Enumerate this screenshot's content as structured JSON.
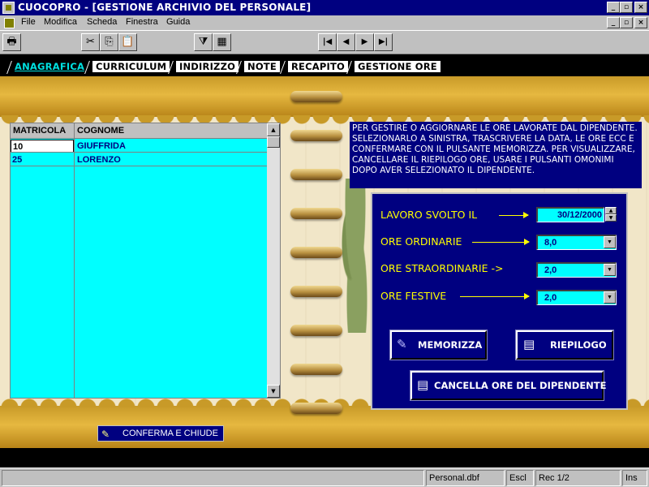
{
  "window": {
    "title": "CUOCOPRO - [GESTIONE ARCHIVIO DEL PERSONALE]",
    "controls": [
      "_",
      "▫",
      "×"
    ],
    "mdi_controls": [
      "_",
      "▫",
      "×"
    ]
  },
  "menu": {
    "items": [
      "File",
      "Modifica",
      "Scheda",
      "Finestra",
      "Guida"
    ]
  },
  "toolbar": {
    "buttons": [
      "printer-icon",
      "scissors-icon",
      "copy-icon",
      "paste-icon",
      "filter-icon",
      "grid-add-icon"
    ],
    "nav": [
      "|◀",
      "◀",
      "▶",
      "▶|"
    ]
  },
  "tabs": {
    "active": "ANAGRAFICA",
    "items": [
      "ANAGRAFICA",
      "CURRICULUM",
      "INDIRIZZO",
      "NOTE",
      "RECAPITO",
      "GESTIONE ORE"
    ]
  },
  "grid": {
    "columns": [
      "MATRICOLA",
      "COGNOME"
    ],
    "rows": [
      {
        "matricola": "10",
        "cognome": "GIUFFRIDA"
      },
      {
        "matricola": "25",
        "cognome": "LORENZO"
      }
    ]
  },
  "info": {
    "text": "PER GESTIRE O AGGIORNARE LE ORE LAVORATE DAL DIPENDENTE. SELEZIONARLO A SINISTRA, TRASCRIVERE LA DATA, LE ORE ECC E CONFERMARE CON IL PULSANTE MEMORIZZA. PER VISUALIZZARE, CANCELLARE IL RIEPILOGO ORE, USARE I PULSANTI OMONIMI DOPO AVER SELEZIONATO IL DIPENDENTE."
  },
  "form": {
    "lavoro_label": "LAVORO SVOLTO IL",
    "lavoro_value": "30/12/2000",
    "ordinarie_label": "ORE ORDINARIE",
    "ordinarie_value": "8,0",
    "straordinarie_label": "ORE STRAORDINARIE ->",
    "straordinarie_value": "2,0",
    "festive_label": "ORE FESTIVE",
    "festive_value": "2,0"
  },
  "buttons": {
    "memorizza": "MEMORIZZA",
    "riepilogo": "RIEPILOGO",
    "cancella": "CANCELLA ORE DEL DIPENDENTE",
    "conferma": "CONFERMA E CHIUDE"
  },
  "status": {
    "file": "Personal.dbf",
    "mode": "Escl",
    "record": "Rec 1/2",
    "ins": "Ins"
  },
  "colors": {
    "title_bar": "#000080",
    "panel": "#000080",
    "grid_bg": "#00ffff",
    "label_yellow": "#ffff00",
    "active_tab": "#00e0e0"
  }
}
